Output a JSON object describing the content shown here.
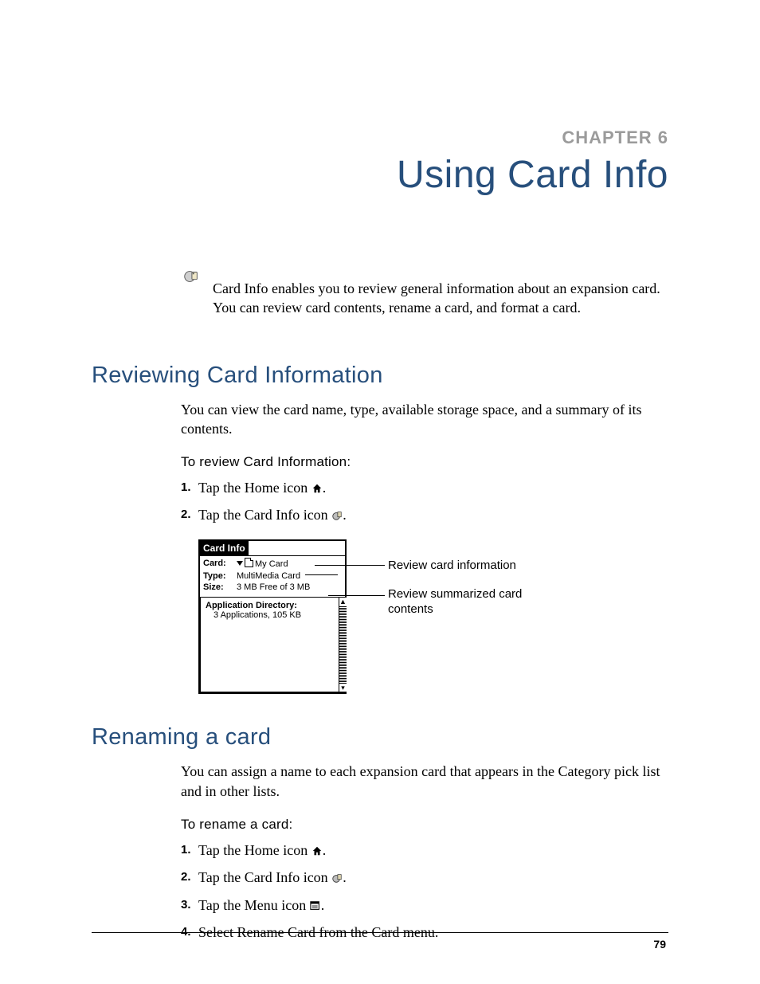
{
  "chapter": {
    "label": "CHAPTER 6",
    "title": "Using Card Info"
  },
  "intro": "Card Info enables you to review general information about an expansion card. You can review card contents, rename a card, and format a card.",
  "sections": {
    "reviewing": {
      "heading": "Reviewing Card Information",
      "body": "You can view the card name, type, available storage space, and a summary of its contents.",
      "procLabel": "To review Card Information:",
      "steps": [
        {
          "pre": "Tap the Home icon ",
          "post": "."
        },
        {
          "pre": "Tap the Card Info icon ",
          "post": "."
        }
      ]
    },
    "renaming": {
      "heading": "Renaming a card",
      "body": "You can assign a name to each expansion card that appears in the Category pick list and in other lists.",
      "procLabel": "To rename a card:",
      "steps": [
        {
          "pre": "Tap the Home icon ",
          "post": "."
        },
        {
          "pre": "Tap the Card Info icon ",
          "post": "."
        },
        {
          "pre": "Tap the Menu icon ",
          "post": "."
        },
        {
          "text": "Select Rename Card from the Card menu."
        }
      ]
    }
  },
  "screenshot": {
    "title": "Card Info",
    "rows": {
      "cardLabel": "Card:",
      "cardValue": "My Card",
      "typeLabel": "Type:",
      "typeValue": "MultiMedia Card",
      "sizeLabel": "Size:",
      "sizeValue": "3 MB Free of 3 MB"
    },
    "dirHeader": "Application Directory:",
    "dirLine": "3 Applications, 105 KB",
    "callout1": "Review card information",
    "callout2": "Review summarized card contents"
  },
  "pageNumber": "79"
}
